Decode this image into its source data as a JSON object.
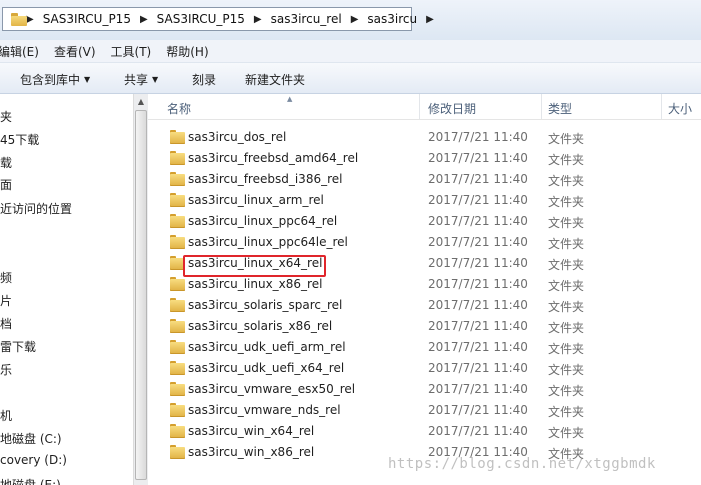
{
  "address": {
    "breadcrumbs": [
      "SAS3IRCU_P15",
      "SAS3IRCU_P15",
      "sas3ircu_rel",
      "sas3ircu"
    ]
  },
  "menu": [
    "编辑(E)",
    "查看(V)",
    "工具(T)",
    "帮助(H)"
  ],
  "commands": {
    "include_library": "包含到库中",
    "share": "共享",
    "burn": "刻录",
    "new_folder": "新建文件夹"
  },
  "nav": {
    "items": [
      "夹",
      "45下载",
      "载",
      "面",
      "近访问的位置",
      "频",
      "片",
      "档",
      "雷下载",
      "乐",
      "机",
      "地磁盘 (C:)",
      "covery (D:)",
      "地磁盘 (E:)"
    ]
  },
  "columns": {
    "name": "名称",
    "date": "修改日期",
    "type": "类型",
    "size": "大小"
  },
  "files": [
    {
      "name": "sas3ircu_dos_rel",
      "date": "2017/7/21 11:40",
      "type": "文件夹"
    },
    {
      "name": "sas3ircu_freebsd_amd64_rel",
      "date": "2017/7/21 11:40",
      "type": "文件夹"
    },
    {
      "name": "sas3ircu_freebsd_i386_rel",
      "date": "2017/7/21 11:40",
      "type": "文件夹"
    },
    {
      "name": "sas3ircu_linux_arm_rel",
      "date": "2017/7/21 11:40",
      "type": "文件夹"
    },
    {
      "name": "sas3ircu_linux_ppc64_rel",
      "date": "2017/7/21 11:40",
      "type": "文件夹"
    },
    {
      "name": "sas3ircu_linux_ppc64le_rel",
      "date": "2017/7/21 11:40",
      "type": "文件夹"
    },
    {
      "name": "sas3ircu_linux_x64_rel",
      "date": "2017/7/21 11:40",
      "type": "文件夹"
    },
    {
      "name": "sas3ircu_linux_x86_rel",
      "date": "2017/7/21 11:40",
      "type": "文件夹"
    },
    {
      "name": "sas3ircu_solaris_sparc_rel",
      "date": "2017/7/21 11:40",
      "type": "文件夹"
    },
    {
      "name": "sas3ircu_solaris_x86_rel",
      "date": "2017/7/21 11:40",
      "type": "文件夹"
    },
    {
      "name": "sas3ircu_udk_uefi_arm_rel",
      "date": "2017/7/21 11:40",
      "type": "文件夹"
    },
    {
      "name": "sas3ircu_udk_uefi_x64_rel",
      "date": "2017/7/21 11:40",
      "type": "文件夹"
    },
    {
      "name": "sas3ircu_vmware_esx50_rel",
      "date": "2017/7/21 11:40",
      "type": "文件夹"
    },
    {
      "name": "sas3ircu_vmware_nds_rel",
      "date": "2017/7/21 11:40",
      "type": "文件夹"
    },
    {
      "name": "sas3ircu_win_x64_rel",
      "date": "2017/7/21 11:40",
      "type": "文件夹"
    },
    {
      "name": "sas3ircu_win_x86_rel",
      "date": "2017/7/21 11:40",
      "type": "文件夹"
    }
  ],
  "watermark": "https://blog.csdn.net/xtggbmdk",
  "colors": {
    "highlight": "#e0252b",
    "header_text": "#4c607a",
    "folder": "#f0c55a"
  }
}
